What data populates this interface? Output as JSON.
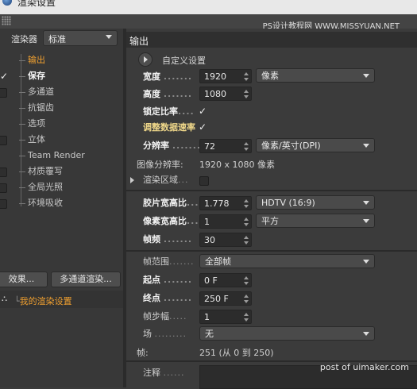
{
  "window": {
    "title": "渲染设置"
  },
  "watermark_top": "PS设计教程网 WWW.MISSYUAN.NET",
  "watermark_bottom": "post of uimaker.com",
  "left": {
    "renderer_label": "渲染器",
    "renderer_value": "标准",
    "items": [
      {
        "label": "输出",
        "active": true
      },
      {
        "label": "保存",
        "active": true
      },
      {
        "label": "多通道"
      },
      {
        "label": "抗锯齿"
      },
      {
        "label": "选项"
      },
      {
        "label": "立体"
      },
      {
        "label": "Team Render"
      },
      {
        "label": "材质覆写"
      },
      {
        "label": "全局光照"
      },
      {
        "label": "环境吸收"
      }
    ],
    "effects_button": "效果...",
    "multipass_button": "多通道渲染...",
    "my_settings": "我的渲染设置"
  },
  "output": {
    "header": "输出",
    "preset_label": "自定义设置",
    "width_label": "宽度",
    "width_value": "1920",
    "unit_value": "像素",
    "height_label": "高度",
    "height_value": "1080",
    "lock_ratio_label": "锁定比率",
    "adjust_rate_label": "调整数据速率",
    "resolution_label": "分辨率",
    "resolution_value": "72",
    "resolution_unit": "像素/英寸(DPI)",
    "image_res_label": "图像分辨率:",
    "image_res_value": "1920 x 1080 像素",
    "render_region_label": "渲染区域",
    "film_aspect_label": "胶片宽高比",
    "film_aspect_value": "1.778",
    "film_aspect_preset": "HDTV (16:9)",
    "pixel_aspect_label": "像素宽高比",
    "pixel_aspect_value": "1",
    "pixel_aspect_preset": "平方",
    "fps_label": "帧频",
    "fps_value": "30",
    "frame_range_label": "帧范围",
    "frame_range_value": "全部帧",
    "start_label": "起点",
    "start_value": "0 F",
    "end_label": "终点",
    "end_value": "250 F",
    "step_label": "帧步幅",
    "step_value": "1",
    "field_label": "场",
    "field_value": "无",
    "frames_label": "帧:",
    "frames_value": "251 (从 0 到 250)",
    "notes_label": "注释"
  },
  "colors": {
    "accent_orange": "#f0a030",
    "bg": "#3b3b3b"
  }
}
